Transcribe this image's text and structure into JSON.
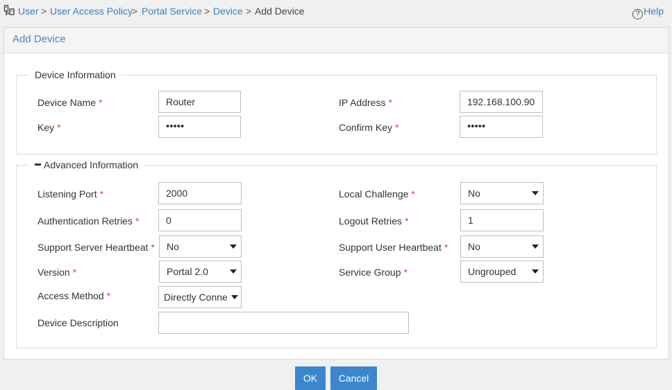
{
  "breadcrumb": {
    "items": [
      "User",
      "User Access Policy",
      "Portal Service",
      "Device"
    ],
    "separator": ">",
    "current": "Add Device"
  },
  "help": {
    "label": "Help",
    "glyph": "?"
  },
  "panel": {
    "title": "Add Device"
  },
  "device_info": {
    "legend": "Device Information",
    "device_name": {
      "label": "Device Name",
      "value": "Router"
    },
    "ip_address": {
      "label": "IP Address",
      "value": "192.168.100.90"
    },
    "key": {
      "label": "Key",
      "value": "•••••"
    },
    "confirm_key": {
      "label": "Confirm Key",
      "value": "•••••"
    }
  },
  "advanced_info": {
    "legend": "Advanced Information",
    "listening_port": {
      "label": "Listening Port",
      "value": "2000"
    },
    "local_challenge": {
      "label": "Local Challenge",
      "value": "No"
    },
    "auth_retries": {
      "label": "Authentication Retries",
      "value": "0"
    },
    "logout_retries": {
      "label": "Logout Retries",
      "value": "1"
    },
    "server_heartbeat": {
      "label": "Support Server Heartbeat",
      "value": "No"
    },
    "user_heartbeat": {
      "label": "Support User Heartbeat",
      "value": "No"
    },
    "version": {
      "label": "Version",
      "value": "Portal 2.0"
    },
    "service_group": {
      "label": "Service Group",
      "value": "Ungrouped"
    },
    "access_method": {
      "label": "Access Method",
      "value": "Directly Conne"
    },
    "device_description": {
      "label": "Device Description",
      "value": ""
    }
  },
  "required_mark": "*",
  "buttons": {
    "ok": "OK",
    "cancel": "Cancel"
  },
  "colors": {
    "link": "#3b7fc4",
    "title": "#4a86c8",
    "button": "#3b86cc",
    "required": "#e04040"
  }
}
